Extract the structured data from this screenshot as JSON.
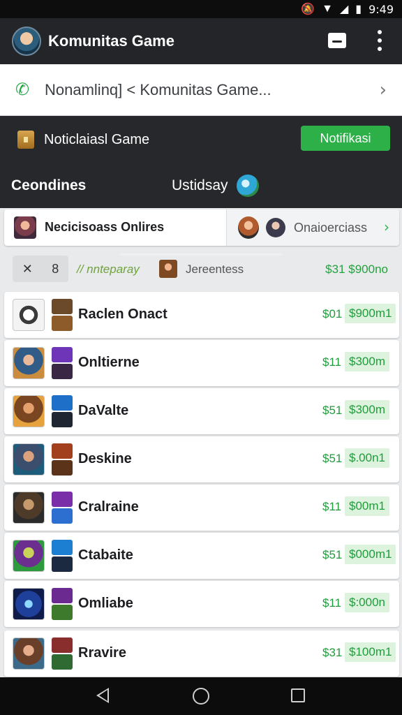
{
  "status_bar": {
    "time": "9:49"
  },
  "header": {
    "title": "Komunitas Game"
  },
  "call_bar": {
    "text": "Nonamlinq] < Komunitas Game..."
  },
  "notice": {
    "title": "Noticlaiasl Game",
    "button": "Notifikasi"
  },
  "tabs": [
    {
      "label": "Ceondines"
    },
    {
      "label": "Ustidsay"
    }
  ],
  "filter": {
    "label": "Necicisoass Onlires",
    "options": "Onaioerciass"
  },
  "subbar": {
    "box_left": "✕",
    "box_right": "8",
    "hint": "// nnteparay",
    "label": "Jereentess",
    "price": "$31 $900no"
  },
  "list": [
    {
      "name": "Raclen Onact",
      "price_left": "$01",
      "price_right": "$900m1"
    },
    {
      "name": "Onltierne",
      "price_left": "$11",
      "price_right": "$300m"
    },
    {
      "name": "DaValte",
      "price_left": "$51",
      "price_right": "$300m"
    },
    {
      "name": "Deskine",
      "price_left": "$51",
      "price_right": "$.00n1"
    },
    {
      "name": "Cralraine",
      "price_left": "$11",
      "price_right": "$00m1"
    },
    {
      "name": "Ctabaite",
      "price_left": "$51",
      "price_right": "$000m1"
    },
    {
      "name": "Omliabe",
      "price_left": "$11",
      "price_right": "$:000n"
    },
    {
      "name": "Rravire",
      "price_left": "$31",
      "price_right": "$100m1"
    }
  ],
  "colors": {
    "accent_green": "#2eb049",
    "header_dark": "#232529",
    "price_green": "#1f9c3b"
  }
}
